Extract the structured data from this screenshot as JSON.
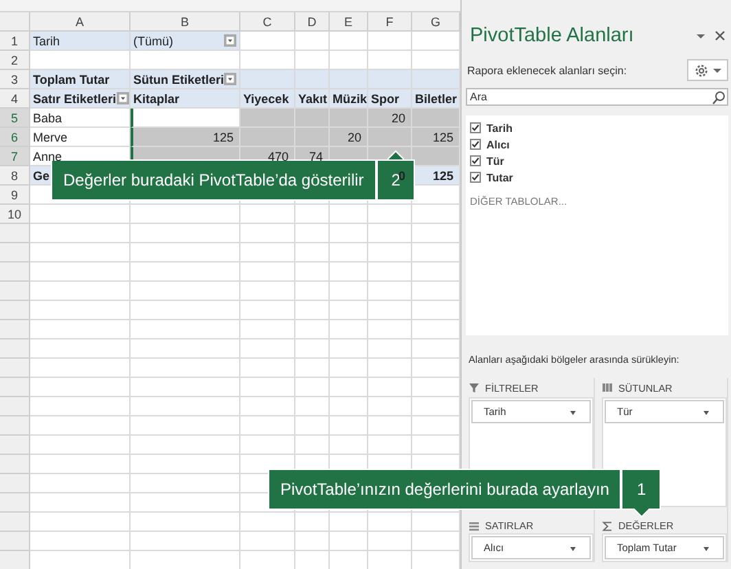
{
  "sheet": {
    "columns": [
      "A",
      "B",
      "C",
      "D",
      "E",
      "F",
      "G"
    ],
    "rows": [
      {
        "number": "1",
        "kind": "filter",
        "cells": [
          {
            "text": "Tarih"
          },
          {
            "text": "(Tümü)",
            "dropdown": true
          },
          {},
          {},
          {},
          {},
          {}
        ]
      },
      {
        "number": "2",
        "kind": "blank",
        "cells": [
          {},
          {},
          {},
          {},
          {},
          {},
          {}
        ]
      },
      {
        "number": "3",
        "kind": "header",
        "cells": [
          {
            "text": "Toplam Tutar"
          },
          {
            "text": "Sütun Etiketleri",
            "dropdown": true
          },
          {},
          {},
          {},
          {},
          {}
        ]
      },
      {
        "number": "4",
        "kind": "header",
        "cells": [
          {
            "text": "Satır Etiketleri",
            "dropdown": true
          },
          {
            "text": "Kitaplar"
          },
          {
            "text": "Yiyecek"
          },
          {
            "text": "Yakıt"
          },
          {
            "text": "Müzik"
          },
          {
            "text": "Spor"
          },
          {
            "text": "Biletler"
          }
        ]
      },
      {
        "number": "5",
        "kind": "value",
        "cells": [
          {
            "text": "Baba",
            "selected": false
          },
          {
            "selected": false
          },
          {
            "selected": true
          },
          {
            "selected": true
          },
          {
            "selected": true
          },
          {
            "text": "20",
            "selected": true
          },
          {
            "selected": true
          }
        ]
      },
      {
        "number": "6",
        "kind": "value",
        "cells": [
          {
            "text": "Merve",
            "selected": false
          },
          {
            "text": "125",
            "selected": true
          },
          {
            "selected": true
          },
          {
            "selected": true
          },
          {
            "text": "20",
            "selected": true
          },
          {
            "selected": true
          },
          {
            "text": "125",
            "selected": true
          }
        ]
      },
      {
        "number": "7",
        "kind": "value",
        "cells": [
          {
            "text": "Anne",
            "selected": false
          },
          {
            "selected": true
          },
          {
            "text": "470",
            "selected": true
          },
          {
            "text": "74",
            "selected": true
          },
          {
            "selected": true
          },
          {
            "selected": true
          },
          {
            "selected": true
          }
        ]
      },
      {
        "number": "8",
        "kind": "total",
        "cells": [
          {
            "text": "Ge"
          },
          {},
          {},
          {},
          {},
          {
            "text": "0"
          },
          {
            "text": "125"
          }
        ]
      },
      {
        "number": "9",
        "kind": "blank",
        "cells": [
          {},
          {},
          {},
          {},
          {},
          {},
          {}
        ]
      },
      {
        "number": "10",
        "kind": "blank",
        "cells": [
          {},
          {},
          {},
          {},
          {},
          {},
          {}
        ]
      }
    ]
  },
  "pane": {
    "title": "PivotTable Alanları",
    "subtitle": "Rapora eklenecek alanları seçin:",
    "search": {
      "placeholder": "Ara"
    },
    "fields": [
      {
        "label": "Tarih",
        "checked": true
      },
      {
        "label": "Alıcı",
        "checked": true
      },
      {
        "label": "Tür",
        "checked": true
      },
      {
        "label": "Tutar",
        "checked": true
      }
    ],
    "more_tables": "DİĞER TABLOLAR...",
    "areas_hint": "Alanları aşağıdaki bölgeler arasında sürükleyin:",
    "areas": [
      {
        "kind": "filters",
        "title": "FİLTRELER",
        "items": [
          "Tarih"
        ]
      },
      {
        "kind": "columns",
        "title": "SÜTUNLAR",
        "items": [
          "Tür"
        ]
      },
      {
        "kind": "rows",
        "title": "SATIRLAR",
        "items": [
          "Alıcı"
        ]
      },
      {
        "kind": "values",
        "title": "DEĞERLER",
        "items": [
          "Toplam Tutar"
        ]
      }
    ]
  },
  "callouts": [
    {
      "text": "Değerler buradaki PivotTable’da gösterilir",
      "number": "2",
      "pointer_up": true
    },
    {
      "text": "PivotTable’ınızın değerlerini burada ayarlayın",
      "number": "1",
      "pointer_up": false
    }
  ]
}
